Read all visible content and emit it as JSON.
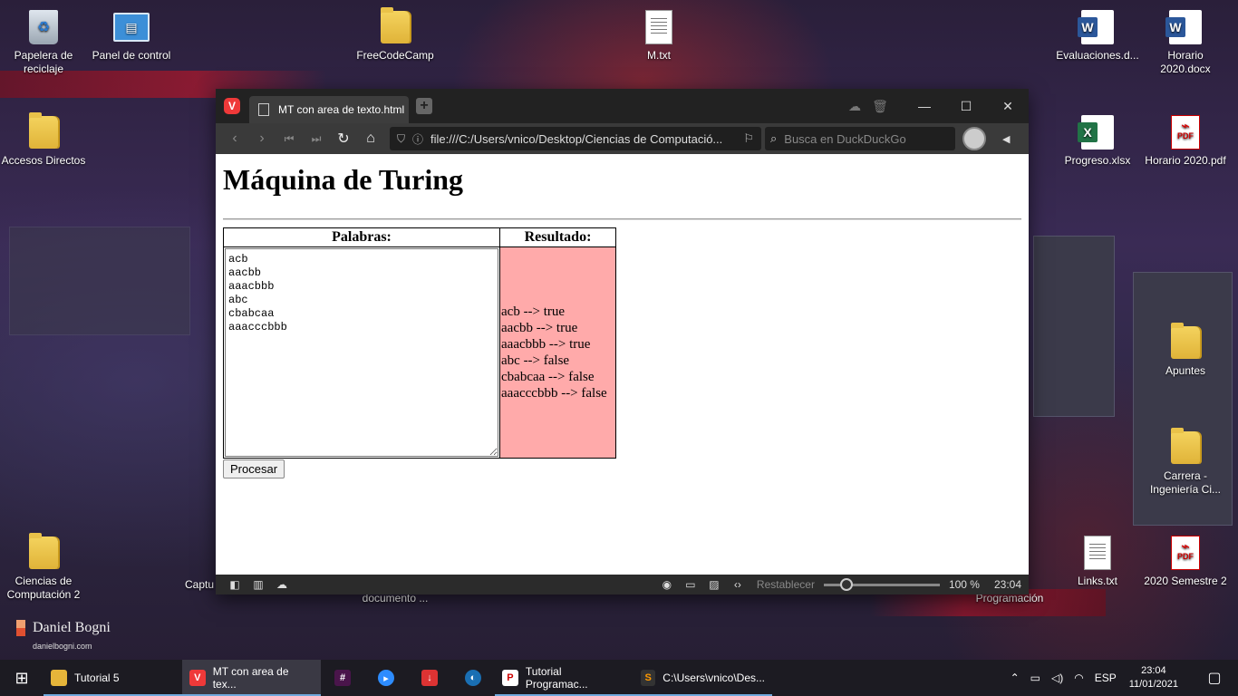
{
  "desktop": {
    "icons": [
      {
        "label": "Papelera de reciclaje",
        "icon": "recycle-bin-icon"
      },
      {
        "label": "Panel de control",
        "icon": "control-panel-icon"
      },
      {
        "label": "FreeCodeCamp",
        "icon": "folder-icon"
      },
      {
        "label": "M.txt",
        "icon": "text-file-icon"
      },
      {
        "label": "Evaluaciones.d...",
        "icon": "word-doc-icon"
      },
      {
        "label": "Horario 2020.docx",
        "icon": "word-doc-icon"
      },
      {
        "label": "Accesos Directos",
        "icon": "folder-icon"
      },
      {
        "label": "Progreso.xlsx",
        "icon": "excel-icon"
      },
      {
        "label": "Horario 2020.pdf",
        "icon": "pdf-icon"
      },
      {
        "label": "Apuntes",
        "icon": "folder-icon"
      },
      {
        "label": "Carrera - Ingeniería Ci...",
        "icon": "folder-icon"
      },
      {
        "label": "Ciencias de Computación 2",
        "icon": "folder-icon"
      },
      {
        "label": "Captu",
        "icon": "file-icon"
      },
      {
        "label": "documento ...",
        "icon": "file-icon"
      },
      {
        "label": "Programación",
        "icon": "file-icon"
      },
      {
        "label": "Links.txt",
        "icon": "text-file-icon"
      },
      {
        "label": "2020 Semestre 2",
        "icon": "pdf-icon"
      }
    ],
    "watermark": {
      "name": "Daniel Bogni",
      "site": "danielbogni.com"
    }
  },
  "browser": {
    "tab_title": "MT con area de texto.html",
    "url": "file:///C:/Users/vnico/Desktop/Ciencias de Computació...",
    "search_placeholder": "Busca en DuckDuckGo",
    "status": {
      "reset_label": "Restablecer",
      "zoom": "100 %",
      "time": "23:04"
    }
  },
  "page": {
    "title": "Máquina de Turing",
    "col_words": "Palabras:",
    "col_result": "Resultado:",
    "words_text": "acb\naacbb\naaacbbb\nabc\ncbabcaa\naaacccbbb",
    "results": [
      "acb --> true",
      "aacbb --> true",
      "aaacbbb --> true",
      "abc --> false",
      "cbabcaa --> false",
      "aaacccbbb --> false"
    ],
    "process_button": "Procesar",
    "result_bg": "#ffaaaa"
  },
  "taskbar": {
    "items": [
      {
        "label": "Tutorial 5",
        "icon": "folder-icon"
      },
      {
        "label": "MT con area de tex...",
        "icon": "vivaldi-icon"
      },
      {
        "label": "",
        "icon": "slack-icon"
      },
      {
        "label": "",
        "icon": "zoom-icon"
      },
      {
        "label": "",
        "icon": "download-icon"
      },
      {
        "label": "",
        "icon": "app-icon"
      },
      {
        "label": "Tutorial Programac...",
        "icon": "pdf-icon"
      },
      {
        "label": "C:\\Users\\vnico\\Des...",
        "icon": "sublime-icon"
      }
    ],
    "tray": {
      "language": "ESP",
      "time": "23:04",
      "date": "11/01/2021"
    }
  }
}
